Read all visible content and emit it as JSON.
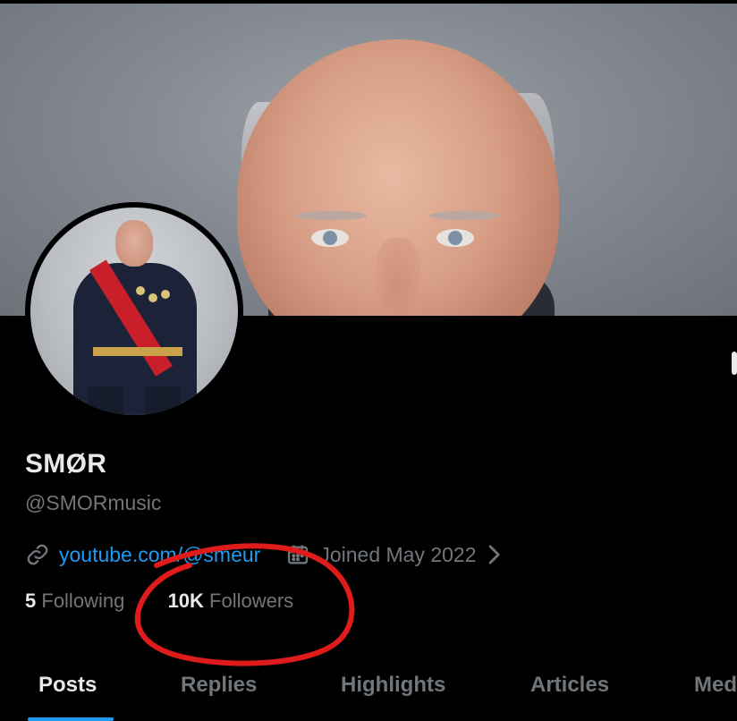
{
  "profile": {
    "display_name": "SMØR",
    "handle": "@SMORmusic",
    "website": "youtube.com/@smeur",
    "joined": "Joined May 2022",
    "following_count": "5",
    "following_label": "Following",
    "followers_count": "10K",
    "followers_label": "Followers"
  },
  "tabs": [
    {
      "label": "Posts",
      "active": true
    },
    {
      "label": "Replies",
      "active": false
    },
    {
      "label": "Highlights",
      "active": false
    },
    {
      "label": "Articles",
      "active": false
    },
    {
      "label": "Med",
      "active": false
    }
  ],
  "icons": {
    "website": "link-icon",
    "joined": "calendar-icon",
    "more": "chevron-right-icon"
  },
  "colors": {
    "background": "#000000",
    "text_primary": "#e7e9ea",
    "text_secondary": "#71767b",
    "link": "#1d9bf0",
    "annotation": "#e01b1b"
  }
}
